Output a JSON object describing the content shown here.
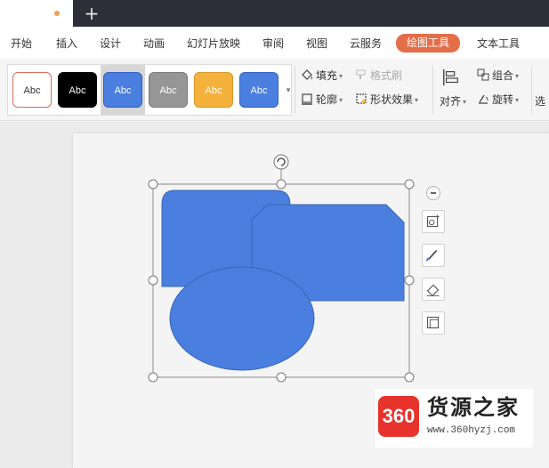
{
  "titlebar": {
    "add_tab_glyph": "+"
  },
  "menu": {
    "items": [
      "开始",
      "插入",
      "设计",
      "动画",
      "幻灯片放映",
      "审阅",
      "视图",
      "云服务",
      "绘图工具",
      "文本工具"
    ],
    "active": "绘图工具"
  },
  "ribbon": {
    "styles": [
      {
        "label": "Abc",
        "fill": "#ffffff",
        "text": "#333333",
        "border": "#e06b5b"
      },
      {
        "label": "Abc",
        "fill": "#000000",
        "text": "#ffffff",
        "border": "#000000"
      },
      {
        "label": "Abc",
        "fill": "#4a7fe0",
        "text": "#ffffff",
        "border": "#3462bf"
      },
      {
        "label": "Abc",
        "fill": "#969696",
        "text": "#ffffff",
        "border": "#7a7a7a"
      },
      {
        "label": "Abc",
        "fill": "#f4b13b",
        "text": "#ffffff",
        "border": "#d8962a"
      },
      {
        "label": "Abc",
        "fill": "#4a7fe0",
        "text": "#ffffff",
        "border": "#3462bf"
      }
    ],
    "fill_label": "填充",
    "format_painter_label": "格式刷",
    "outline_label": "轮廓",
    "shape_effects_label": "形状效果",
    "align_label": "对齐",
    "group_label": "组合",
    "rotate_label": "旋转",
    "select_label": "选"
  },
  "colors": {
    "shape_fill": "#4a7fe0",
    "shape_stroke": "#3a64b0",
    "accent": "#e46e4a",
    "titlebar": "#2e2e38"
  },
  "side_tools": [
    "shape-insert-icon",
    "brush-icon",
    "eraser-icon",
    "frame-icon"
  ],
  "watermark": {
    "badge": "360",
    "title": "货源之家",
    "url": "www.360hyzj.com"
  }
}
